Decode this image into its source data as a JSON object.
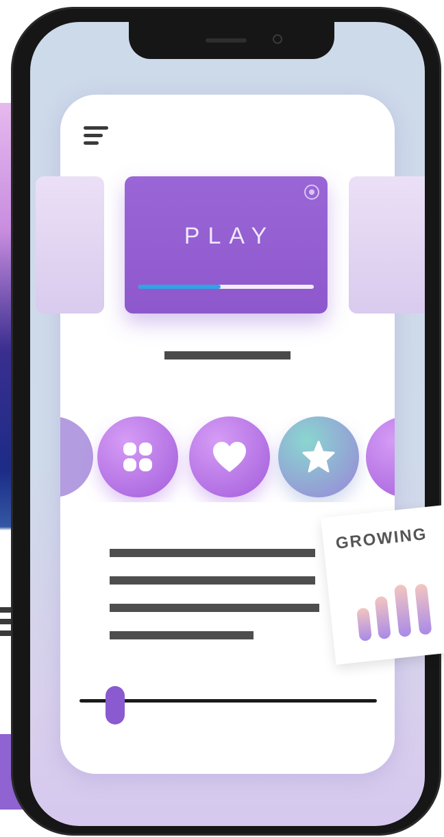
{
  "play_card": {
    "label": "PLAY",
    "progress": 0.47,
    "progress_color": "#2ea3e6",
    "background": "#9a66d6"
  },
  "feature_icons": [
    "clover-icon",
    "heart-icon",
    "star-icon"
  ],
  "badge": {
    "label": "GROWING"
  },
  "slider": {
    "value": 0.12,
    "thumb_color": "#8a5ad0"
  }
}
